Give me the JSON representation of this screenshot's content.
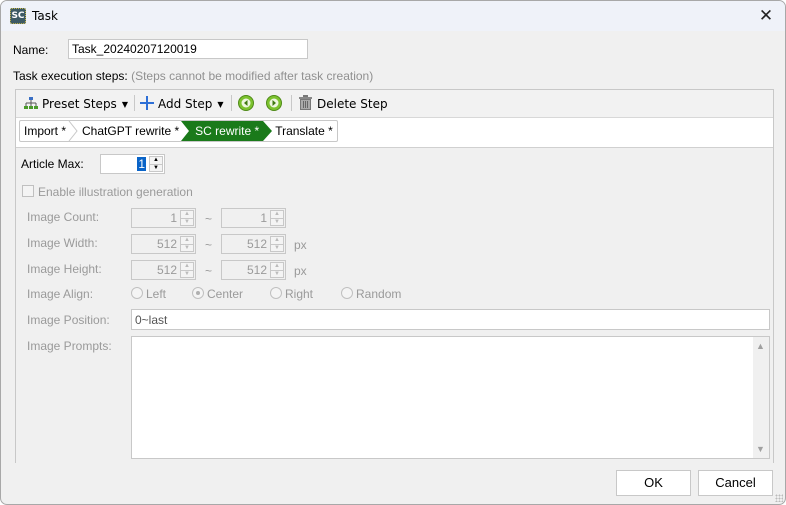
{
  "window": {
    "title": "Task",
    "app_icon_text": "SC",
    "close_icon": "close-icon"
  },
  "form": {
    "name_label": "Name:",
    "name_value": "Task_20240207120019",
    "steps_label": "Task execution steps:",
    "steps_hint": "(Steps cannot be modified after task creation)"
  },
  "toolbar": {
    "preset_steps": "Preset Steps",
    "add_step": "Add Step",
    "move_left_icon": "arrow-left-circle-icon",
    "move_right_icon": "arrow-right-circle-icon",
    "delete_step": "Delete Step"
  },
  "steps": [
    {
      "label": "Import *",
      "active": false
    },
    {
      "label": "ChatGPT rewrite *",
      "active": false
    },
    {
      "label": "SC rewrite *",
      "active": true
    },
    {
      "label": "Translate *",
      "active": false
    }
  ],
  "step_settings": {
    "article_max_label": "Article Max:",
    "article_max_value": "1",
    "enable_illustration_label": "Enable illustration generation",
    "enable_illustration_checked": false,
    "image_count_label": "Image Count:",
    "image_count_min": "1",
    "image_count_max": "1",
    "image_width_label": "Image Width:",
    "image_width_min": "512",
    "image_width_max": "512",
    "image_height_label": "Image Height:",
    "image_height_min": "512",
    "image_height_max": "512",
    "range_sep": "~",
    "unit_px": "px",
    "image_align_label": "Image Align:",
    "align_options": [
      {
        "label": "Left",
        "checked": false
      },
      {
        "label": "Center",
        "checked": true
      },
      {
        "label": "Right",
        "checked": false
      },
      {
        "label": "Random",
        "checked": false
      }
    ],
    "image_position_label": "Image Position:",
    "image_position_value": "0~last",
    "image_prompts_label": "Image Prompts:",
    "image_prompts_value": ""
  },
  "footer": {
    "ok": "OK",
    "cancel": "Cancel"
  },
  "colors": {
    "active_step": "#1a7a1a",
    "selection": "#0a64c8"
  }
}
